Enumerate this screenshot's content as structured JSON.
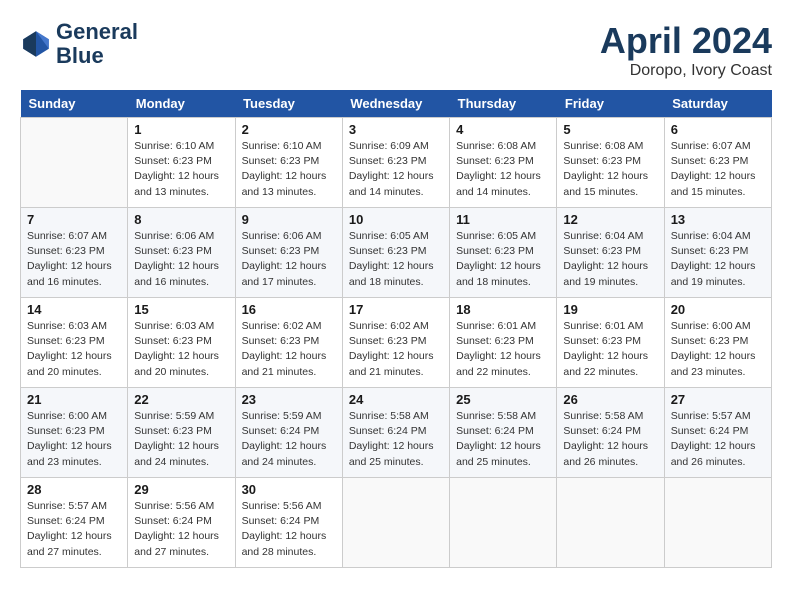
{
  "header": {
    "logo_line1": "General",
    "logo_line2": "Blue",
    "month": "April 2024",
    "location": "Doropo, Ivory Coast"
  },
  "days_of_week": [
    "Sunday",
    "Monday",
    "Tuesday",
    "Wednesday",
    "Thursday",
    "Friday",
    "Saturday"
  ],
  "weeks": [
    [
      {
        "day": "",
        "info": ""
      },
      {
        "day": "1",
        "info": "Sunrise: 6:10 AM\nSunset: 6:23 PM\nDaylight: 12 hours\nand 13 minutes."
      },
      {
        "day": "2",
        "info": "Sunrise: 6:10 AM\nSunset: 6:23 PM\nDaylight: 12 hours\nand 13 minutes."
      },
      {
        "day": "3",
        "info": "Sunrise: 6:09 AM\nSunset: 6:23 PM\nDaylight: 12 hours\nand 14 minutes."
      },
      {
        "day": "4",
        "info": "Sunrise: 6:08 AM\nSunset: 6:23 PM\nDaylight: 12 hours\nand 14 minutes."
      },
      {
        "day": "5",
        "info": "Sunrise: 6:08 AM\nSunset: 6:23 PM\nDaylight: 12 hours\nand 15 minutes."
      },
      {
        "day": "6",
        "info": "Sunrise: 6:07 AM\nSunset: 6:23 PM\nDaylight: 12 hours\nand 15 minutes."
      }
    ],
    [
      {
        "day": "7",
        "info": "Sunrise: 6:07 AM\nSunset: 6:23 PM\nDaylight: 12 hours\nand 16 minutes."
      },
      {
        "day": "8",
        "info": "Sunrise: 6:06 AM\nSunset: 6:23 PM\nDaylight: 12 hours\nand 16 minutes."
      },
      {
        "day": "9",
        "info": "Sunrise: 6:06 AM\nSunset: 6:23 PM\nDaylight: 12 hours\nand 17 minutes."
      },
      {
        "day": "10",
        "info": "Sunrise: 6:05 AM\nSunset: 6:23 PM\nDaylight: 12 hours\nand 18 minutes."
      },
      {
        "day": "11",
        "info": "Sunrise: 6:05 AM\nSunset: 6:23 PM\nDaylight: 12 hours\nand 18 minutes."
      },
      {
        "day": "12",
        "info": "Sunrise: 6:04 AM\nSunset: 6:23 PM\nDaylight: 12 hours\nand 19 minutes."
      },
      {
        "day": "13",
        "info": "Sunrise: 6:04 AM\nSunset: 6:23 PM\nDaylight: 12 hours\nand 19 minutes."
      }
    ],
    [
      {
        "day": "14",
        "info": "Sunrise: 6:03 AM\nSunset: 6:23 PM\nDaylight: 12 hours\nand 20 minutes."
      },
      {
        "day": "15",
        "info": "Sunrise: 6:03 AM\nSunset: 6:23 PM\nDaylight: 12 hours\nand 20 minutes."
      },
      {
        "day": "16",
        "info": "Sunrise: 6:02 AM\nSunset: 6:23 PM\nDaylight: 12 hours\nand 21 minutes."
      },
      {
        "day": "17",
        "info": "Sunrise: 6:02 AM\nSunset: 6:23 PM\nDaylight: 12 hours\nand 21 minutes."
      },
      {
        "day": "18",
        "info": "Sunrise: 6:01 AM\nSunset: 6:23 PM\nDaylight: 12 hours\nand 22 minutes."
      },
      {
        "day": "19",
        "info": "Sunrise: 6:01 AM\nSunset: 6:23 PM\nDaylight: 12 hours\nand 22 minutes."
      },
      {
        "day": "20",
        "info": "Sunrise: 6:00 AM\nSunset: 6:23 PM\nDaylight: 12 hours\nand 23 minutes."
      }
    ],
    [
      {
        "day": "21",
        "info": "Sunrise: 6:00 AM\nSunset: 6:23 PM\nDaylight: 12 hours\nand 23 minutes."
      },
      {
        "day": "22",
        "info": "Sunrise: 5:59 AM\nSunset: 6:23 PM\nDaylight: 12 hours\nand 24 minutes."
      },
      {
        "day": "23",
        "info": "Sunrise: 5:59 AM\nSunset: 6:24 PM\nDaylight: 12 hours\nand 24 minutes."
      },
      {
        "day": "24",
        "info": "Sunrise: 5:58 AM\nSunset: 6:24 PM\nDaylight: 12 hours\nand 25 minutes."
      },
      {
        "day": "25",
        "info": "Sunrise: 5:58 AM\nSunset: 6:24 PM\nDaylight: 12 hours\nand 25 minutes."
      },
      {
        "day": "26",
        "info": "Sunrise: 5:58 AM\nSunset: 6:24 PM\nDaylight: 12 hours\nand 26 minutes."
      },
      {
        "day": "27",
        "info": "Sunrise: 5:57 AM\nSunset: 6:24 PM\nDaylight: 12 hours\nand 26 minutes."
      }
    ],
    [
      {
        "day": "28",
        "info": "Sunrise: 5:57 AM\nSunset: 6:24 PM\nDaylight: 12 hours\nand 27 minutes."
      },
      {
        "day": "29",
        "info": "Sunrise: 5:56 AM\nSunset: 6:24 PM\nDaylight: 12 hours\nand 27 minutes."
      },
      {
        "day": "30",
        "info": "Sunrise: 5:56 AM\nSunset: 6:24 PM\nDaylight: 12 hours\nand 28 minutes."
      },
      {
        "day": "",
        "info": ""
      },
      {
        "day": "",
        "info": ""
      },
      {
        "day": "",
        "info": ""
      },
      {
        "day": "",
        "info": ""
      }
    ]
  ]
}
